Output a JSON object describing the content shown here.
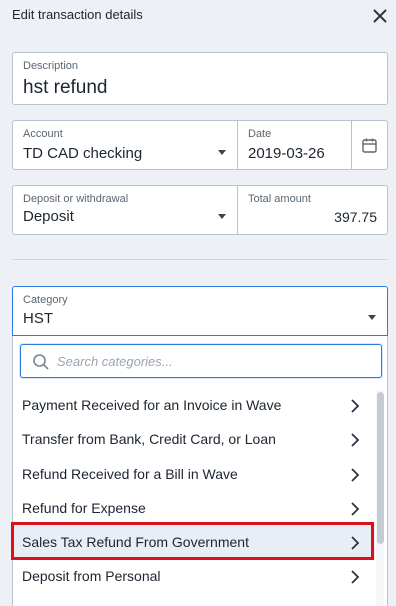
{
  "header": {
    "title": "Edit transaction details"
  },
  "description": {
    "label": "Description",
    "value": "hst refund"
  },
  "account": {
    "label": "Account",
    "value": "TD CAD checking"
  },
  "date": {
    "label": "Date",
    "value": "2019-03-26"
  },
  "deposit": {
    "label": "Deposit or withdrawal",
    "value": "Deposit"
  },
  "amount": {
    "label": "Total amount",
    "value": "397.75"
  },
  "category": {
    "label": "Category",
    "value": "HST",
    "search_placeholder": "Search categories...",
    "items": [
      {
        "label": "Payment Received for an Invoice in Wave"
      },
      {
        "label": "Transfer from Bank, Credit Card, or Loan"
      },
      {
        "label": "Refund Received for a Bill in Wave"
      },
      {
        "label": "Refund for Expense"
      },
      {
        "label": "Sales Tax Refund From Government"
      },
      {
        "label": "Deposit from Personal"
      }
    ]
  },
  "colors": {
    "accent": "#2a7be4",
    "highlight": "#e0101a",
    "background": "#edf1f5"
  },
  "icons": [
    "close-icon",
    "calendar-icon",
    "chevron-down-icon",
    "search-icon",
    "chevron-right-icon"
  ]
}
